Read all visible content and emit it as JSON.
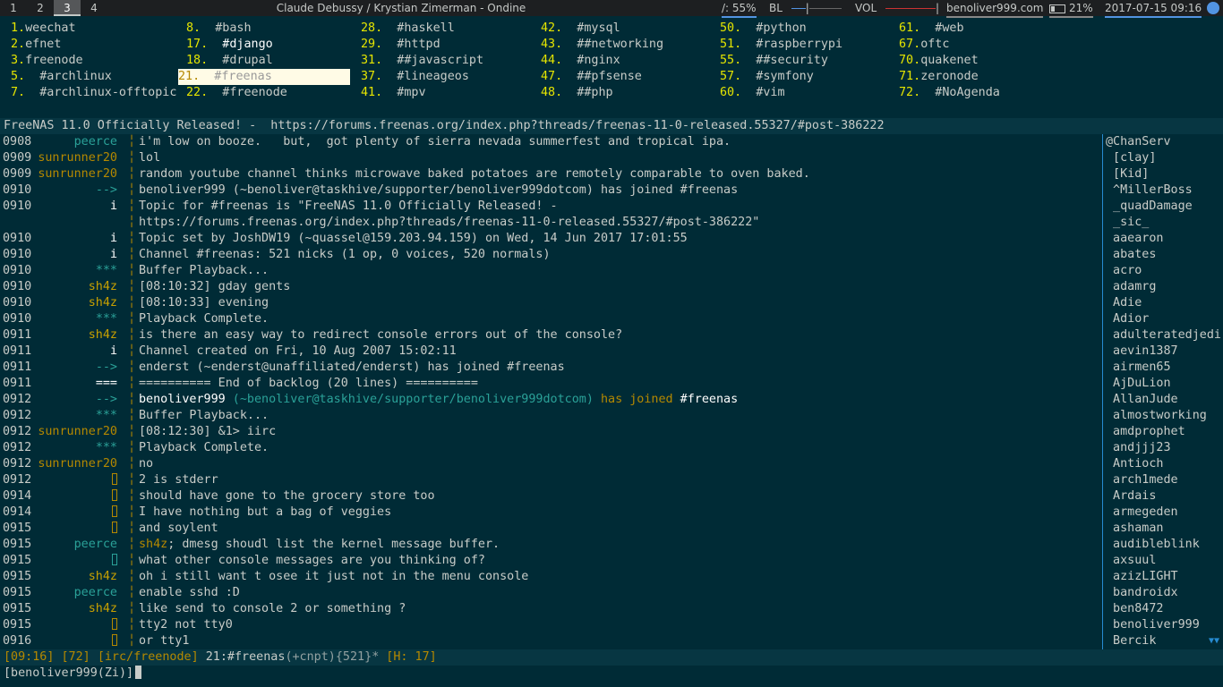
{
  "topbar": {
    "workspaces": [
      "1",
      "2",
      "3",
      "4"
    ],
    "active_workspace": "3",
    "window_title": "Claude Debussy / Krystian Zimerman - Ondine",
    "cpu": "/: 55%",
    "bl_label": "BL",
    "vol_label": "VOL",
    "host": "benoliver999.com",
    "battery": "21%",
    "datetime": "2017-07-15 09:16"
  },
  "buflist": [
    [
      "1.",
      "weechat"
    ],
    [
      "2.",
      "efnet"
    ],
    [
      "3.",
      "freenode"
    ],
    [
      "5.",
      "  #archlinux"
    ],
    [
      "7.",
      "  #archlinux-offtopic"
    ],
    [
      "8.",
      "  #bash"
    ],
    [
      "17.",
      "  #django"
    ],
    [
      "18.",
      "  #drupal"
    ],
    [
      "21.",
      "  #freenas"
    ],
    [
      "22.",
      "  #freenode"
    ],
    [
      "28.",
      "  #haskell"
    ],
    [
      "29.",
      "  #httpd"
    ],
    [
      "31.",
      "  ##javascript"
    ],
    [
      "37.",
      "  #lineageos"
    ],
    [
      "41.",
      "  #mpv"
    ],
    [
      "42.",
      "  #mysql"
    ],
    [
      "43.",
      "  ##networking"
    ],
    [
      "44.",
      "  #nginx"
    ],
    [
      "47.",
      "  ##pfsense"
    ],
    [
      "48.",
      "  ##php"
    ],
    [
      "50.",
      "  #python"
    ],
    [
      "51.",
      "  #raspberrypi"
    ],
    [
      "55.",
      "  ##security"
    ],
    [
      "57.",
      "  #symfony"
    ],
    [
      "60.",
      "  #vim"
    ],
    [
      "61.",
      "  #web"
    ],
    [
      "67.",
      "oftc"
    ],
    [
      "70.",
      "quakenet"
    ],
    [
      "71.",
      "zeronode"
    ],
    [
      "72.",
      "  #NoAgenda"
    ]
  ],
  "topic": "FreeNAS 11.0 Officially Released! -  https://forums.freenas.org/index.php?threads/freenas-11-0-released.55327/#post-386222",
  "chat": [
    {
      "ts": "0908",
      "nick": "peerce",
      "msg": "i'm low on booze.   but,  got plenty of sierra nevada summerfest and tropical ipa."
    },
    {
      "ts": "0909",
      "nick": "sunrunner20",
      "msg": "lol"
    },
    {
      "ts": "0909",
      "nick": "sunrunner20",
      "msg": "random youtube channel thinks microwave baked potatoes are remotely comparable to oven baked."
    },
    {
      "ts": "0910",
      "nick": "-->",
      "msg": "benoliver999 (~benoliver@taskhive/supporter/benoliver999dotcom) has joined #freenas"
    },
    {
      "ts": "0910",
      "nick": "i",
      "msg": "Topic for #freenas is \"FreeNAS 11.0 Officially Released! -"
    },
    {
      "ts": "",
      "nick": "",
      "msg": "https://forums.freenas.org/index.php?threads/freenas-11-0-released.55327/#post-386222\""
    },
    {
      "ts": "0910",
      "nick": "i",
      "msg": "Topic set by JoshDW19 (~quassel@159.203.94.159) on Wed, 14 Jun 2017 17:01:55"
    },
    {
      "ts": "0910",
      "nick": "i",
      "msg": "Channel #freenas: 521 nicks (1 op, 0 voices, 520 normals)"
    },
    {
      "ts": "0910",
      "nick": "***",
      "msg": "Buffer Playback..."
    },
    {
      "ts": "0910",
      "nick": "sh4z",
      "msg": "[08:10:32] gday gents"
    },
    {
      "ts": "0910",
      "nick": "sh4z",
      "msg": "[08:10:33] evening"
    },
    {
      "ts": "0910",
      "nick": "***",
      "msg": "Playback Complete."
    },
    {
      "ts": "0911",
      "nick": "sh4z",
      "msg": "is there an easy way to redirect console errors out of the console?"
    },
    {
      "ts": "0911",
      "nick": "i",
      "msg": "Channel created on Fri, 10 Aug 2007 15:02:11"
    },
    {
      "ts": "0911",
      "nick": "-->",
      "msg": "enderst (~enderst@unaffiliated/enderst) has joined #freenas"
    },
    {
      "ts": "0911",
      "nick": "===",
      "msg": "========== End of backlog (20 lines) =========="
    },
    {
      "ts": "0912",
      "nick": "-->",
      "msg_parts": [
        "benoliver999",
        " (~benoliver@taskhive/supporter/benoliver999dotcom)",
        " has joined ",
        "#freenas"
      ]
    },
    {
      "ts": "0912",
      "nick": "***",
      "msg": "Buffer Playback..."
    },
    {
      "ts": "0912",
      "nick": "sunrunner20",
      "msg": "[08:12:30] &1> iirc"
    },
    {
      "ts": "0912",
      "nick": "***",
      "msg": "Playback Complete."
    },
    {
      "ts": "0912",
      "nick": "sunrunner20",
      "msg": "no"
    },
    {
      "ts": "0912",
      "nick": "",
      "msg": "2 is stderr"
    },
    {
      "ts": "0914",
      "nick": "",
      "msg": "should have gone to the grocery store too"
    },
    {
      "ts": "0914",
      "nick": "",
      "msg": "I have nothing but a bag of veggies"
    },
    {
      "ts": "0915",
      "nick": "",
      "msg": "and soylent"
    },
    {
      "ts": "0915",
      "nick": "peerce",
      "msg_hl": "sh4z",
      "msg": "; dmesg shoudl list the kernel message buffer."
    },
    {
      "ts": "0915",
      "nick": "",
      "msg": "what other console messages are you thinking of?"
    },
    {
      "ts": "0915",
      "nick": "sh4z",
      "msg": "oh i still want t osee it just not in the menu console"
    },
    {
      "ts": "0915",
      "nick": "peerce",
      "msg": "enable sshd :D"
    },
    {
      "ts": "0915",
      "nick": "sh4z",
      "msg": "like send to console 2 or something ?"
    },
    {
      "ts": "0915",
      "nick": "",
      "msg": "tty2 not tty0"
    },
    {
      "ts": "0916",
      "nick": "",
      "msg": "or tty1"
    }
  ],
  "nicklist": [
    "@ChanServ",
    " [clay]",
    " [Kid]",
    " ^MillerBoss",
    " _quadDamage",
    " _sic_",
    " aaearon",
    " abates",
    " acro",
    " adamrg",
    " Adie",
    " Adior",
    " adulteratedjedi",
    " aevin1387",
    " airmen65",
    " AjDuLion",
    " AllanJude",
    " almostworking",
    " amdprophet",
    " andjjj23",
    " Antioch",
    " arch1mede",
    " Ardais",
    " armegeden",
    " ashaman",
    " audibleblink",
    " axsuul",
    " azizLIGHT",
    " bandroidx",
    " ben8472",
    " benoliver999",
    " Bercik"
  ],
  "nicklist_more": "▼▼",
  "status": {
    "time": "[09:16]",
    "num": "[72]",
    "server": "[irc/freenode]",
    "buffer": " 21:#freenas",
    "modes": "(+cnpt)",
    "nicks": "{521}",
    "star": "*",
    "hot": " [H: 17]"
  },
  "input": {
    "prompt": "[benoliver999(Zi)]"
  }
}
